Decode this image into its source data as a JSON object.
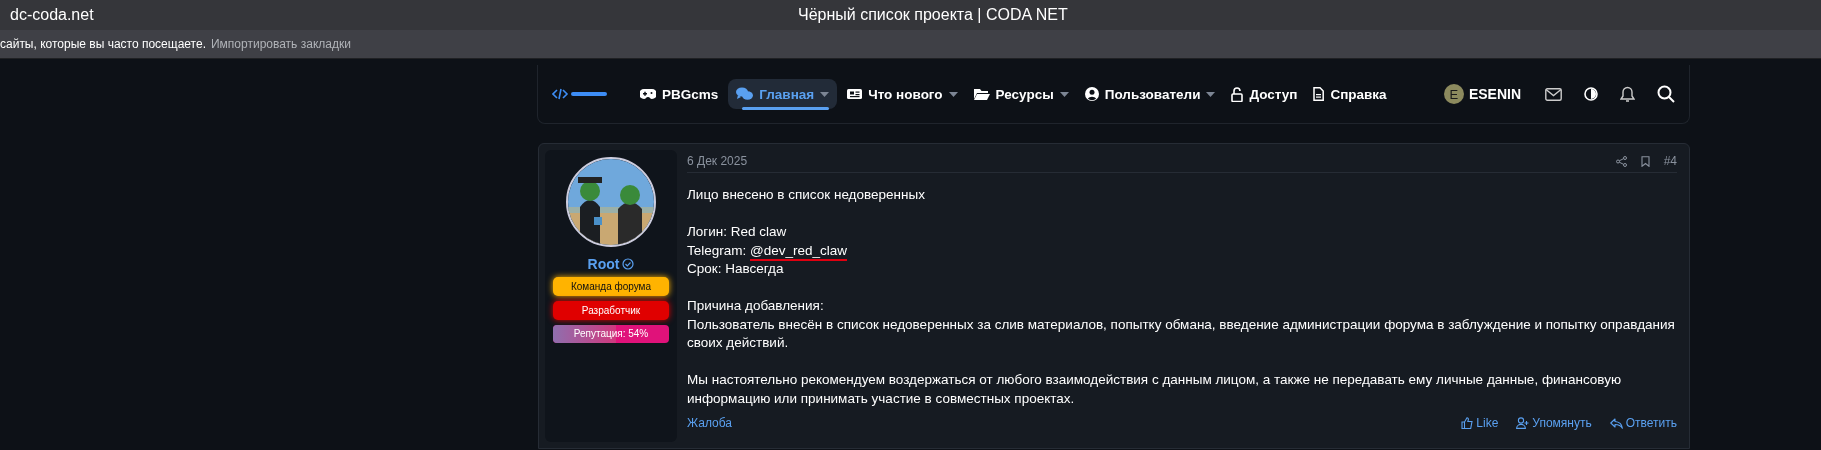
{
  "browser": {
    "domain": "dc-coda.net",
    "title": "Чёрный список проекта | CODA NET"
  },
  "bookmarks_bar": {
    "text": "сайты, которые вы часто посещаете.",
    "link": "Импортировать закладки"
  },
  "nav": {
    "items": [
      {
        "label": "PBGcms",
        "selected": false,
        "dropdown": false
      },
      {
        "label": "Главная",
        "selected": true,
        "dropdown": true
      },
      {
        "label": "Что нового",
        "selected": false,
        "dropdown": true
      },
      {
        "label": "Ресурсы",
        "selected": false,
        "dropdown": true
      },
      {
        "label": "Пользователи",
        "selected": false,
        "dropdown": true
      },
      {
        "label": "Доступ",
        "selected": false,
        "dropdown": false
      },
      {
        "label": "Справка",
        "selected": false,
        "dropdown": false
      }
    ],
    "account": {
      "initial": "E",
      "name": "ESENIN"
    }
  },
  "post": {
    "author": {
      "name": "Root",
      "verified": true,
      "badges": [
        {
          "label": "Команда форума",
          "color": "#ffb300"
        },
        {
          "label": "Разработчик",
          "color": "#e00000"
        }
      ],
      "reputation": {
        "label": "Репутация: 54%",
        "level": 0.54
      }
    },
    "date": "6 Дек 2025",
    "number": "#4",
    "paragraphs": [
      [
        {
          "text": "Лицо внесено в список недоверенных"
        }
      ],
      [
        {
          "text": "Логин: Red claw"
        },
        {
          "text": "Telegram:",
          "value": "@dev_red_claw",
          "underlined": true
        },
        {
          "text": "Срок: Навсегда"
        }
      ],
      [
        {
          "text": "Причина добавления:"
        },
        {
          "text": "Пользователь внесён в список недоверенных за слив материалов, попытку обмана, введение администрации форума в заблуждение и попытку оправдания своих действий."
        }
      ],
      [
        {
          "text": "Мы настоятельно рекомендуем воздержаться от любого взаимодействия с данным лицом, а также не передавать ему личные данные, финансовую информацию или принимать участие в совместных проектах."
        }
      ]
    ],
    "report": "Жалоба",
    "actions": [
      {
        "label": "Like"
      },
      {
        "label": "Упомянуть"
      },
      {
        "label": "Ответить"
      }
    ]
  }
}
